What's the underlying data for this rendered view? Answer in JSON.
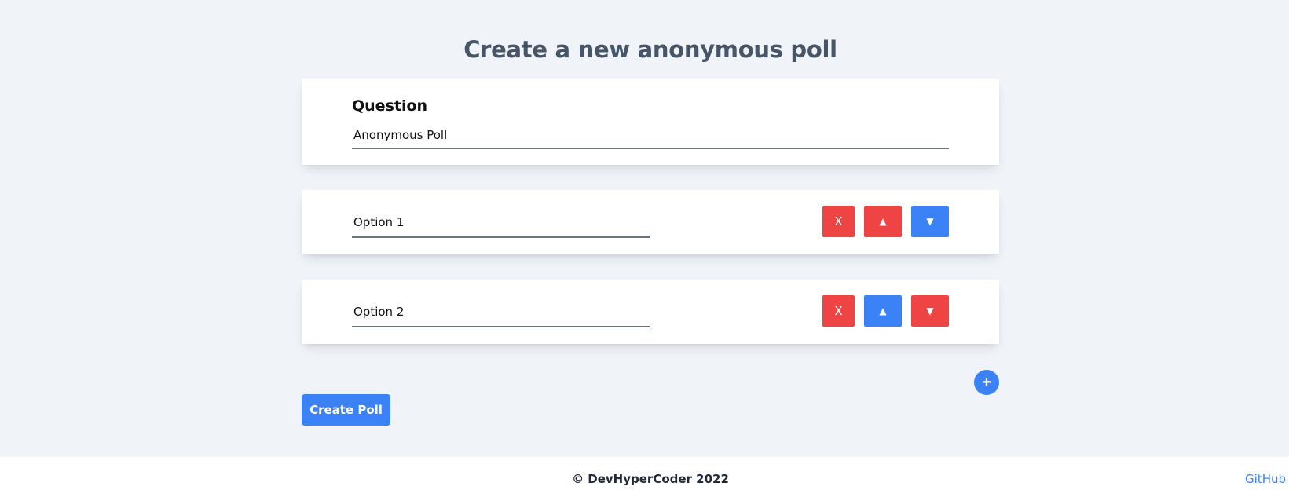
{
  "page": {
    "title": "Create a new anonymous poll"
  },
  "question": {
    "label": "Question",
    "value": "Anonymous Poll"
  },
  "options": [
    {
      "value": "Option 1",
      "remove_label": "X",
      "move_up_label": "▲",
      "move_down_label": "▼",
      "remove_color": "#ef4444",
      "move_up_color": "#ef4444",
      "move_down_color": "#3b82f6"
    },
    {
      "value": "Option 2",
      "remove_label": "X",
      "move_up_label": "▲",
      "move_down_label": "▼",
      "remove_color": "#ef4444",
      "move_up_color": "#3b82f6",
      "move_down_color": "#ef4444"
    }
  ],
  "actions": {
    "add_option_label": "+",
    "create_label": "Create Poll"
  },
  "footer": {
    "copyright": "© DevHyperCoder 2022",
    "github_label": "GitHub"
  },
  "colors": {
    "primary": "#3b82f6",
    "danger": "#ef4444",
    "background": "#f0f3f8",
    "title": "#475569"
  }
}
